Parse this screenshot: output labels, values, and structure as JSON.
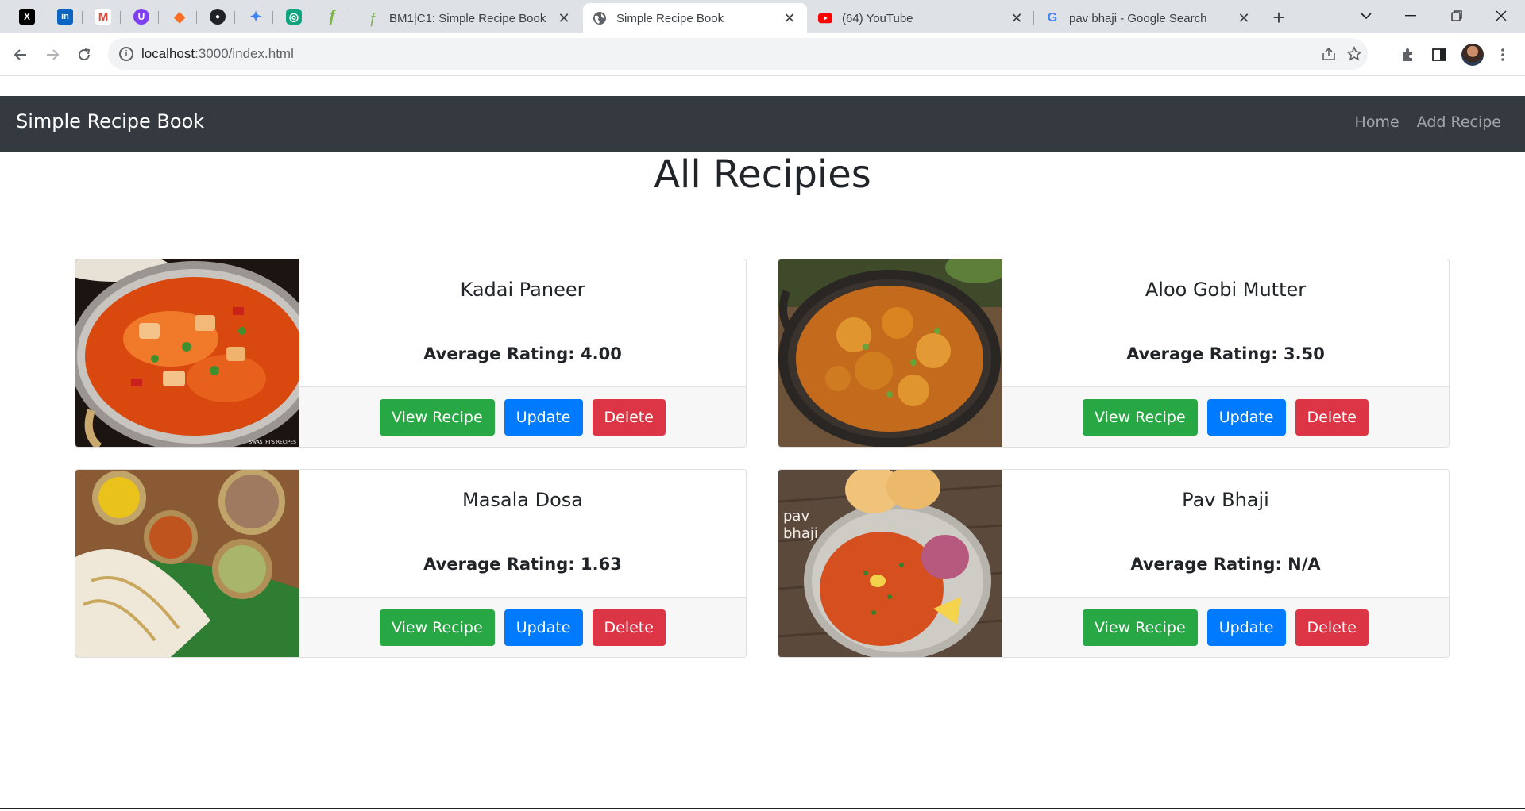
{
  "browser": {
    "pinned_tabs": [
      {
        "icon": "x-twitter-icon",
        "glyph": "X",
        "color": "#000000"
      },
      {
        "icon": "linkedin-icon",
        "glyph": "in",
        "color": "#0a66c2"
      },
      {
        "icon": "gmail-icon",
        "glyph": "M",
        "color": "#ea4335"
      },
      {
        "icon": "u-icon",
        "glyph": "U",
        "color": "#7e3ff2"
      },
      {
        "icon": "gitlab-icon",
        "glyph": "◆",
        "color": "#fc6d26"
      },
      {
        "icon": "github-icon",
        "glyph": "●",
        "color": "#1f2328"
      },
      {
        "icon": "gemini-icon",
        "glyph": "✦",
        "color": "#4285f4"
      },
      {
        "icon": "chatgpt-icon",
        "glyph": "◎",
        "color": "#10a37f"
      },
      {
        "icon": "app-icon",
        "glyph": "ƒ",
        "color": "#7cb342"
      }
    ],
    "tabs": [
      {
        "title": "BM1|C1: Simple Recipe Book",
        "icon": "app-icon",
        "active": false
      },
      {
        "title": "Simple Recipe Book",
        "icon": "globe-icon",
        "active": true
      },
      {
        "title": "(64) YouTube",
        "icon": "youtube-icon",
        "active": false
      },
      {
        "title": "pav bhaji - Google Search",
        "icon": "google-icon",
        "active": false
      }
    ],
    "url_host": "localhost",
    "url_rest": ":3000/index.html"
  },
  "navbar": {
    "brand": "Simple Recipe Book",
    "links": [
      "Home",
      "Add Recipe"
    ]
  },
  "page_title": "All Recipies",
  "recipes": [
    {
      "name": "Kadai Paneer",
      "rating_text": "Average Rating: 4.00",
      "image": "kadai-paneer-image"
    },
    {
      "name": "Aloo Gobi Mutter",
      "rating_text": "Average Rating: 3.50",
      "image": "aloo-gobi-mutter-image"
    },
    {
      "name": "Masala Dosa",
      "rating_text": "Average Rating: 1.63",
      "image": "masala-dosa-image"
    },
    {
      "name": "Pav Bhaji",
      "rating_text": "Average Rating: N/A",
      "image": "pav-bhaji-image"
    }
  ],
  "card_buttons": {
    "view": "View Recipe",
    "update": "Update",
    "delete": "Delete"
  },
  "image_caption": "pav\nbhaji",
  "image_watermark": "SWASTHI'S RECIPES",
  "colors": {
    "navbar": "#343a40",
    "success": "#28a745",
    "primary": "#007bff",
    "danger": "#dc3545"
  }
}
